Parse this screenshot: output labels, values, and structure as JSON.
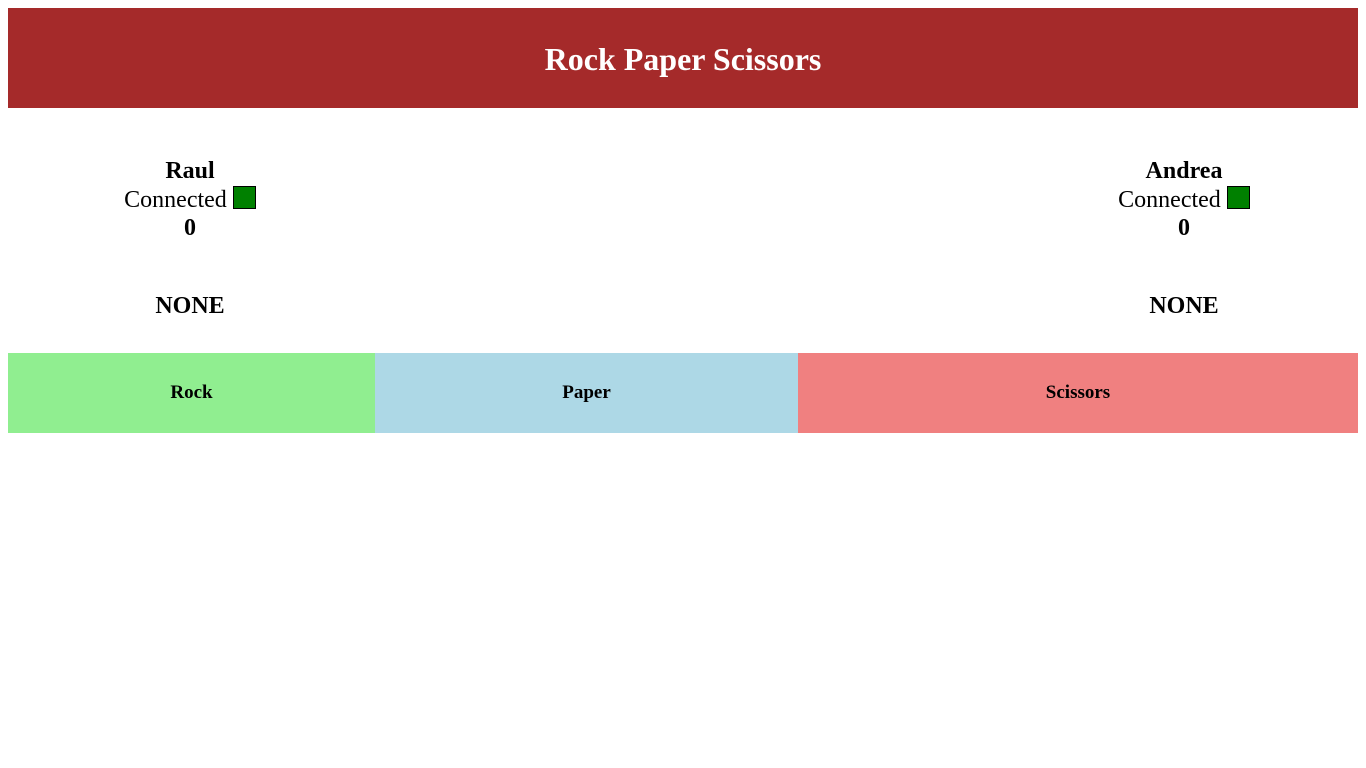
{
  "header": {
    "title": "Rock Paper Scissors",
    "background_color": "#a52a2a"
  },
  "players": [
    {
      "name": "Raul",
      "status": "Connected",
      "status_color": "#008000",
      "score": "0",
      "choice": "NONE"
    },
    {
      "name": "Andrea",
      "status": "Connected",
      "status_color": "#008000",
      "score": "0",
      "choice": "NONE"
    }
  ],
  "buttons": [
    {
      "label": "Rock",
      "color": "#90ee90"
    },
    {
      "label": "Paper",
      "color": "#add8e6"
    },
    {
      "label": "Scissors",
      "color": "#f08080"
    }
  ]
}
